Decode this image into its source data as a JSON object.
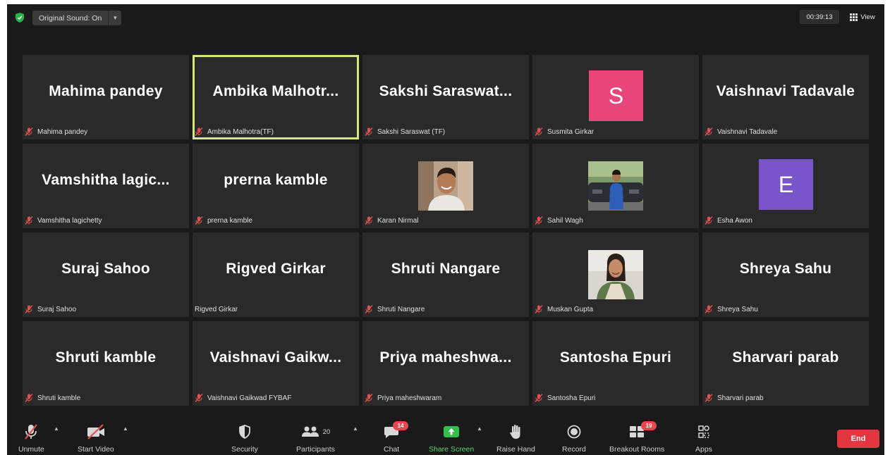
{
  "topbar": {
    "sound_label": "Original Sound: On",
    "timer": "00:39:13",
    "view_label": "View"
  },
  "participants": [
    {
      "big": "Mahima pandey",
      "name": "Mahima pandey",
      "muted": true
    },
    {
      "big": "Ambika  Malhotr...",
      "name": "Ambika Malhotra(TF)",
      "muted": true,
      "active": true
    },
    {
      "big": "Sakshi  Saraswat...",
      "name": "Sakshi Saraswat (TF)",
      "muted": true
    },
    {
      "big": "S",
      "name": "Susmita Girkar",
      "muted": true,
      "avatar_color": "#e8467a"
    },
    {
      "big": "Vaishnavi Tadavale",
      "name": "Vaishnavi Tadavale",
      "muted": true
    },
    {
      "big": "Vamshitha  lagic...",
      "name": "Vamshitha lagichetty",
      "muted": true
    },
    {
      "big": "prerna kamble",
      "name": "prerna kamble",
      "muted": true
    },
    {
      "name": "Karan Nirmal",
      "muted": true,
      "photo": "karan"
    },
    {
      "name": "Sahil Wagh",
      "muted": true,
      "photo": "sahil"
    },
    {
      "big": "E",
      "name": "Esha Awon",
      "muted": true,
      "avatar_color": "#7a55c9"
    },
    {
      "big": "Suraj Sahoo",
      "name": "Suraj Sahoo",
      "muted": true
    },
    {
      "big": "Rigved Girkar",
      "name": "Rigved Girkar",
      "muted": false
    },
    {
      "big": "Shruti Nangare",
      "name": "Shruti Nangare",
      "muted": true
    },
    {
      "name": "Muskan Gupta",
      "muted": true,
      "photo": "muskan"
    },
    {
      "big": "Shreya Sahu",
      "name": "Shreya Sahu",
      "muted": true
    },
    {
      "big": "Shruti kamble",
      "name": "Shruti kamble",
      "muted": true
    },
    {
      "big": "Vaishnavi  Gaikw...",
      "name": "Vaishnavi Gaikwad FYBAF",
      "muted": true
    },
    {
      "big": "Priya  maheshwa...",
      "name": "Priya maheshwaram",
      "muted": true
    },
    {
      "big": "Santosha Epuri",
      "name": "Santosha Epuri",
      "muted": true
    },
    {
      "big": "Sharvari parab",
      "name": "Sharvari parab",
      "muted": true
    }
  ],
  "toolbar": {
    "unmute": "Unmute",
    "start_video": "Start Video",
    "security": "Security",
    "participants": "Participants",
    "participants_count": "20",
    "chat": "Chat",
    "chat_badge": "14",
    "share_screen": "Share Screen",
    "raise_hand": "Raise Hand",
    "record": "Record",
    "breakout_rooms": "Breakout Rooms",
    "breakout_badge": "19",
    "apps": "Apps",
    "end": "End"
  },
  "colors": {
    "active_speaker_border": "#d4e87a",
    "share_green": "#5ed46b",
    "end_red": "#e4363f",
    "badge_red": "#e8474e",
    "muted_mic": "#e0524f"
  }
}
